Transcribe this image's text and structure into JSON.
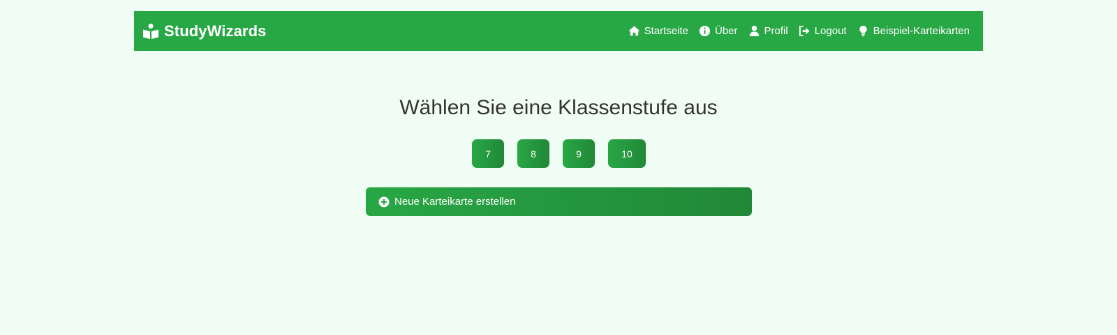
{
  "navbar": {
    "brand": {
      "icon": "book-reader-icon",
      "name": "StudyWizards"
    },
    "links": [
      {
        "icon": "home-icon",
        "label": "Startseite"
      },
      {
        "icon": "info-circle-icon",
        "label": "Über"
      },
      {
        "icon": "user-icon",
        "label": "Profil"
      },
      {
        "icon": "logout-icon",
        "label": "Logout"
      },
      {
        "icon": "lightbulb-icon",
        "label": "Beispiel-Karteikarten"
      }
    ]
  },
  "main": {
    "title": "Wählen Sie eine Klassenstufe aus",
    "grades": [
      "7",
      "8",
      "9",
      "10"
    ],
    "new_card": {
      "icon": "plus-circle-icon",
      "label": "Neue Karteikarte erstellen"
    }
  },
  "colors": {
    "primary": "#28a745",
    "primary_dark": "#218838",
    "background": "#f0fdf4",
    "title_text": "#333333"
  }
}
